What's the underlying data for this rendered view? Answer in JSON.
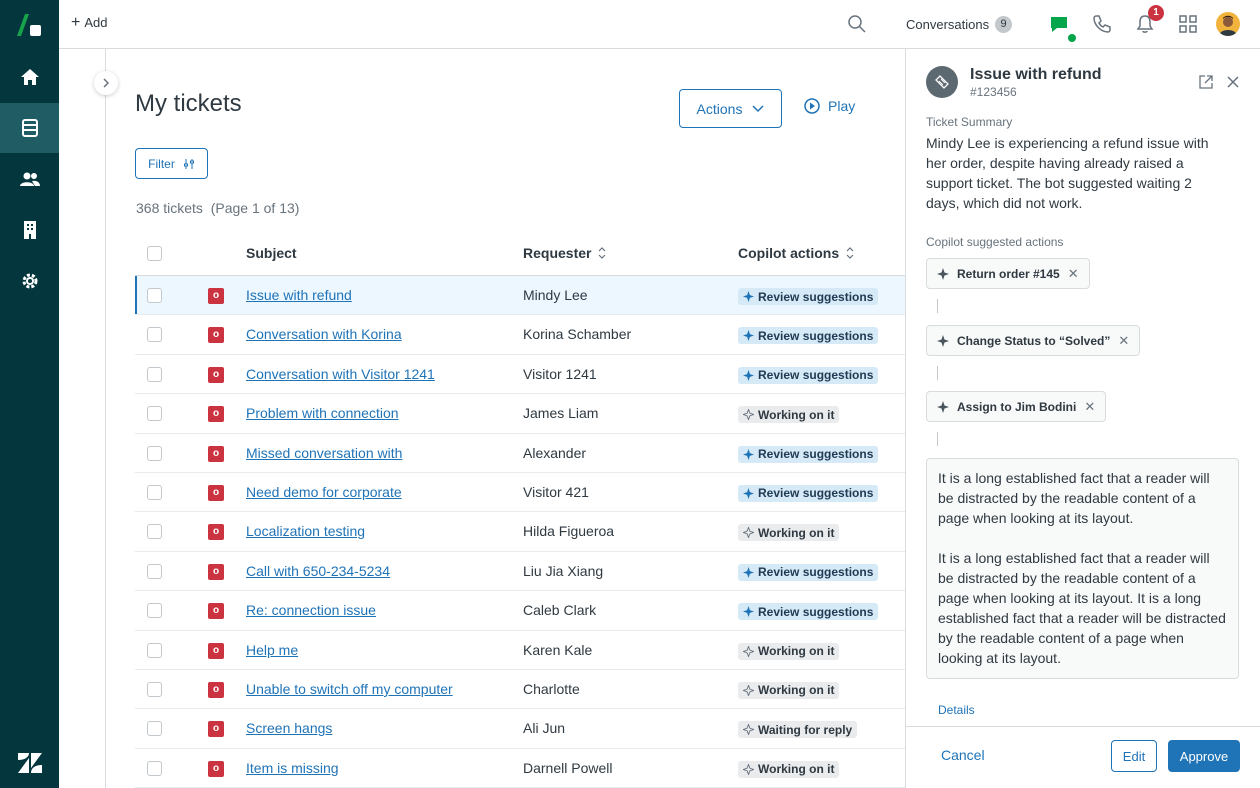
{
  "nav": {
    "items": [
      {
        "icon": "home-icon"
      },
      {
        "icon": "tickets-icon",
        "active": true
      },
      {
        "icon": "users-icon"
      },
      {
        "icon": "organizations-icon"
      },
      {
        "icon": "settings-icon"
      }
    ]
  },
  "topbar": {
    "add_label": "Add",
    "conversations_label": "Conversations",
    "conversations_count": "9",
    "notification_count": "1"
  },
  "main": {
    "title": "My tickets",
    "actions_label": "Actions",
    "play_label": "Play",
    "filter_label": "Filter",
    "ticket_count": "368 tickets",
    "page_info": "(Page 1 of 13)",
    "columns": {
      "subject": "Subject",
      "requester": "Requester",
      "copilot": "Copilot actions"
    },
    "rows": [
      {
        "status": "o",
        "subject": "Issue with refund",
        "requester": "Mindy Lee",
        "action": "Review suggestions",
        "type": "review",
        "selected": true
      },
      {
        "status": "o",
        "subject": "Conversation with Korina",
        "requester": "Korina Schamber",
        "action": "Review suggestions",
        "type": "review"
      },
      {
        "status": "o",
        "subject": "Conversation with Visitor 1241",
        "requester": "Visitor 1241",
        "action": "Review suggestions",
        "type": "review"
      },
      {
        "status": "o",
        "subject": "Problem with connection",
        "requester": "James Liam",
        "action": "Working on it",
        "type": "working"
      },
      {
        "status": "o",
        "subject": "Missed conversation with",
        "requester": "Alexander",
        "action": "Review suggestions",
        "type": "review"
      },
      {
        "status": "o",
        "subject": "Need demo for corporate",
        "requester": "Visitor 421",
        "action": "Review suggestions",
        "type": "review"
      },
      {
        "status": "o",
        "subject": "Localization testing",
        "requester": "Hilda Figueroa",
        "action": "Working on it",
        "type": "working"
      },
      {
        "status": "o",
        "subject": "Call with 650-234-5234",
        "requester": "Liu Jia Xiang",
        "action": "Review suggestions",
        "type": "review"
      },
      {
        "status": "o",
        "subject": "Re: connection issue",
        "requester": "Caleb Clark",
        "action": "Review suggestions",
        "type": "review"
      },
      {
        "status": "o",
        "subject": "Help me",
        "requester": "Karen Kale",
        "action": "Working on it",
        "type": "working"
      },
      {
        "status": "o",
        "subject": "Unable to switch off my computer",
        "requester": "Charlotte",
        "action": "Working on it",
        "type": "working"
      },
      {
        "status": "o",
        "subject": "Screen hangs",
        "requester": "Ali Jun",
        "action": "Waiting for reply",
        "type": "working"
      },
      {
        "status": "o",
        "subject": "Item is missing",
        "requester": "Darnell Powell",
        "action": "Working on it",
        "type": "working"
      }
    ]
  },
  "panel": {
    "title": "Issue with refund",
    "ticket_id": "#123456",
    "summary_label": "Ticket Summary",
    "summary": "Mindy Lee is experiencing a refund issue with her order, despite having already raised a support ticket. The bot suggested waiting 2 days, which did not work.",
    "suggested_label": "Copilot suggested actions",
    "suggested_actions": [
      "Return order #145",
      "Change Status to “Solved”",
      "Assign to Jim Bodini"
    ],
    "note_paragraphs": [
      "It is a long established fact that a reader will be distracted by the readable content of a page when looking at its layout.",
      "It is a long established fact that a reader will be distracted by the readable content of a page when looking at its layout. It is a long established fact that a reader will be distracted by the readable content of a page when looking at its layout."
    ],
    "details_label": "Details",
    "cancel_label": "Cancel",
    "edit_label": "Edit",
    "approve_label": "Approve"
  }
}
